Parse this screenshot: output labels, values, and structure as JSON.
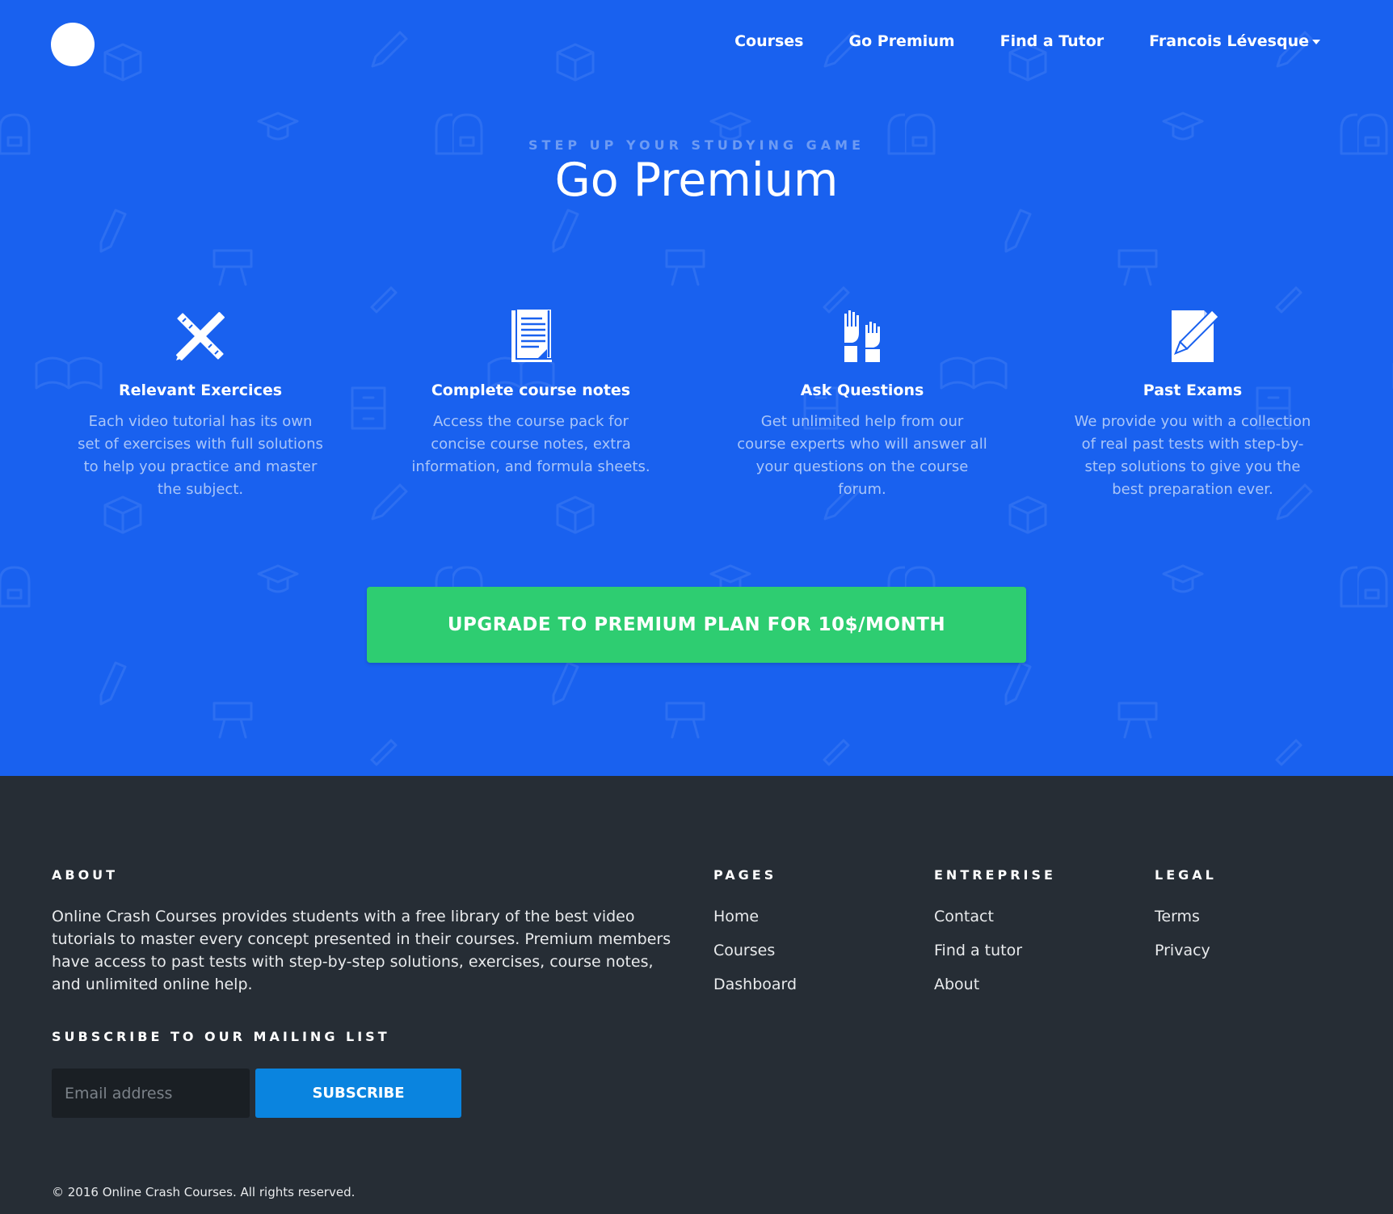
{
  "colors": {
    "hero_bg": "#1961ef",
    "cta_bg": "#2ecd71",
    "footer_bg": "#262d35",
    "subscribe_bg": "#0a84df"
  },
  "nav": {
    "links": [
      "Courses",
      "Go Premium",
      "Find a Tutor"
    ],
    "user_name": "Francois Lévesque"
  },
  "hero": {
    "eyebrow": "STEP UP YOUR STUDYING GAME",
    "title": "Go Premium"
  },
  "features": [
    {
      "icon": "pencil-ruler-icon",
      "title": "Relevant Exercices",
      "description": "Each video tutorial has its own set of exercises with full solutions to help you practice and master the subject."
    },
    {
      "icon": "notes-icon",
      "title": "Complete course notes",
      "description": "Access the course pack for concise course notes, extra information, and formula sheets."
    },
    {
      "icon": "raised-hands-icon",
      "title": "Ask Questions",
      "description": "Get unlimited help from our course experts who will answer all your questions on the course forum."
    },
    {
      "icon": "exam-pencil-icon",
      "title": "Past Exams",
      "description": "We provide you with a collection of real past tests with step-by-step solutions to give you the best preparation ever."
    }
  ],
  "cta": {
    "label": "UPGRADE TO PREMIUM PLAN FOR 10$/MONTH"
  },
  "footer": {
    "about": {
      "heading": "ABOUT",
      "text": "Online Crash Courses provides students with a free library of the best video tutorials to master every concept presented in their courses. Premium members have access to past tests with step-by-step solutions, exercises, course notes, and unlimited online help."
    },
    "pages": {
      "heading": "PAGES",
      "links": [
        "Home",
        "Courses",
        "Dashboard"
      ]
    },
    "entreprise": {
      "heading": "ENTREPRISE",
      "links": [
        "Contact",
        "Find a tutor",
        "About"
      ]
    },
    "legal": {
      "heading": "LEGAL",
      "links": [
        "Terms",
        "Privacy"
      ]
    },
    "subscribe": {
      "heading": "SUBSCRIBE TO OUR MAILING LIST",
      "placeholder": "Email address",
      "button": "SUBSCRIBE"
    },
    "copyright": "© 2016 Online Crash Courses. All rights reserved."
  }
}
